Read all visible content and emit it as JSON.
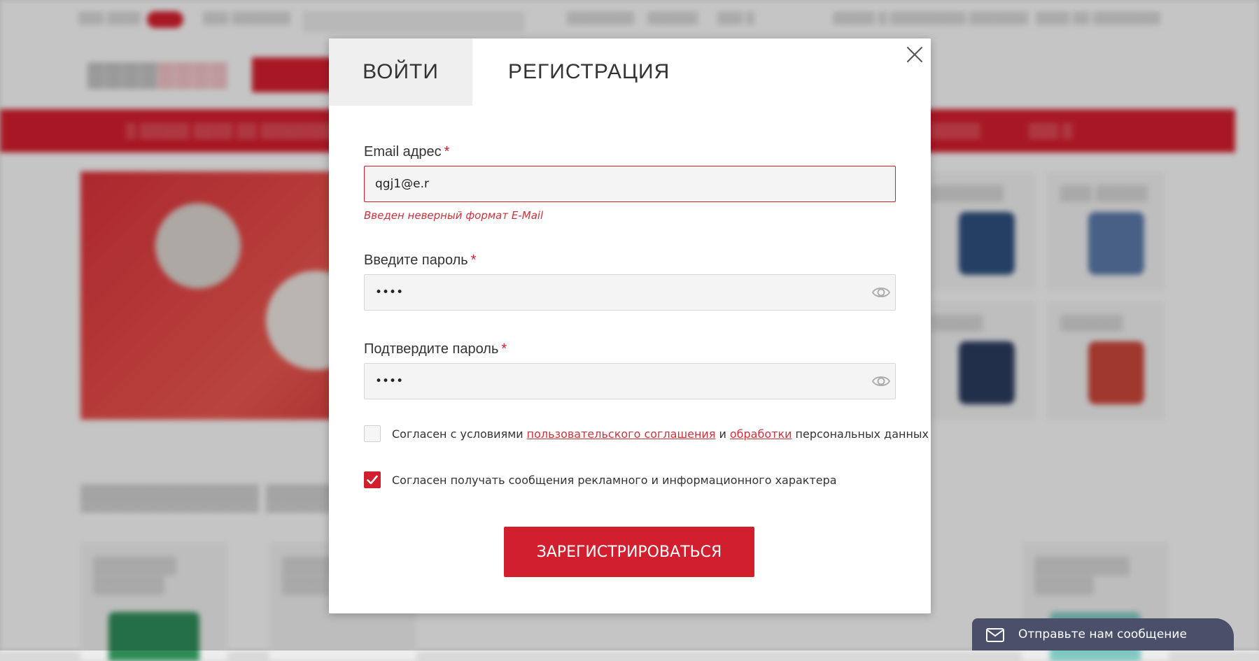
{
  "modal": {
    "tabs": {
      "login": "ВОЙТИ",
      "register": "РЕГИСТРАЦИЯ"
    },
    "email": {
      "label": "Email адрес",
      "required_mark": "*",
      "value": "qgj1@e.r",
      "error": "Введен неверный формат E-Mail"
    },
    "password": {
      "label": "Введите пароль",
      "required_mark": "*",
      "value": "1234"
    },
    "confirm_password": {
      "label": "Подтвердите пароль",
      "required_mark": "*",
      "value": "1234"
    },
    "agreement": {
      "checked": false,
      "text_before": "Согласен с условиями",
      "link1": "пользовательского соглашения",
      "text_mid": "и",
      "link2": "обработки",
      "text_after": "персональных данных"
    },
    "marketing": {
      "checked": true,
      "text": "Согласен получать сообщения рекламного и информационного характера"
    },
    "submit_label": "ЗАРЕГИСТРИРОВАТЬСЯ"
  },
  "chat_widget": {
    "label": "Отправьте нам сообщение",
    "icon": "envelope-icon"
  },
  "colors": {
    "brand_red": "#d21f2d",
    "error_red": "#c9343d",
    "chat_bg": "#4a4f6a"
  }
}
